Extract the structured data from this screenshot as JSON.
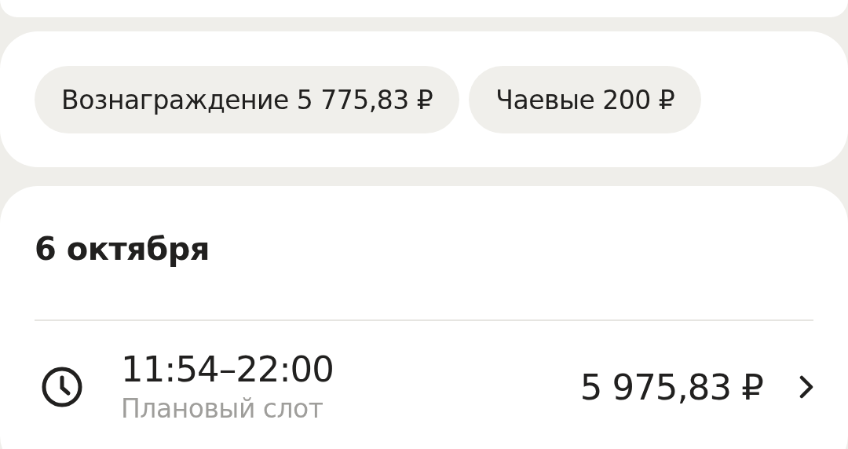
{
  "chips": [
    {
      "label": "Вознаграждение 5 775,83 ₽"
    },
    {
      "label": "Чаевые 200 ₽"
    }
  ],
  "day": {
    "date": "6 октября",
    "slots": [
      {
        "time": "11:54–22:00",
        "type": "Плановый слот",
        "amount": "5 975,83 ₽"
      }
    ]
  }
}
